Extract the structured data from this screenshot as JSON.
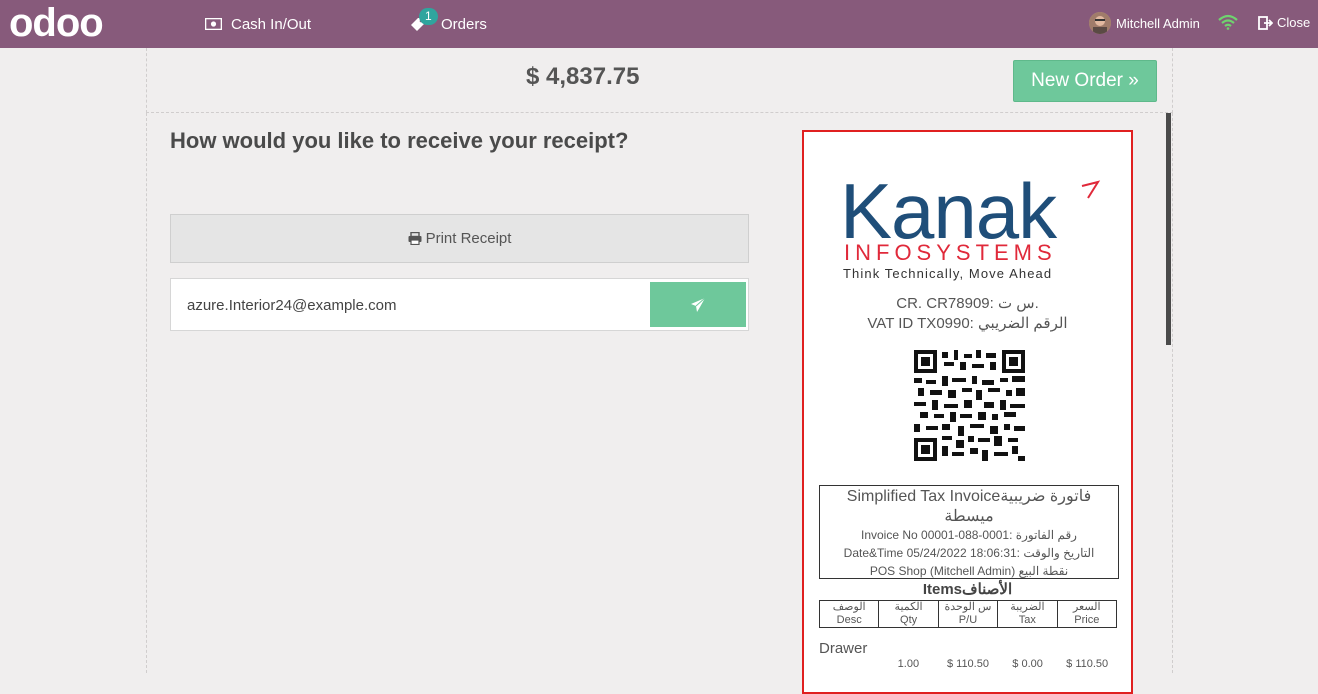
{
  "navbar": {
    "brand": "odoo",
    "cash_label": "Cash In/Out",
    "orders_label": "Orders",
    "orders_count": "1",
    "user_name": "Mitchell Admin",
    "close_label": "Close"
  },
  "payment": {
    "total": "$ 4,837.75",
    "new_order_label": "New Order »"
  },
  "receipt_screen": {
    "question": "How would you like to receive your receipt?",
    "print_label": "Print Receipt",
    "email_value": "azure.Interior24@example.com"
  },
  "receipt": {
    "company_name": "Kanak",
    "company_sub": "INFOSYSTEMS",
    "company_tagline": "Think Technically, Move Ahead",
    "cr_line": "CR. CR78909: س ت.",
    "vat_line": "VAT ID TX0990: الرقم الضريبي",
    "invoice_title_1": "Simplified Tax Invoiceفاتورة ضريبية",
    "invoice_title_2": "ميسطة",
    "invoice_no": "Invoice No 00001-088-0001: رقم الفاتورة",
    "datetime": "Date&Time 05/24/2022 18:06:31: التاريخ والوقت",
    "pos_shop": "POS Shop (Mitchell Admin) نقطة البيع",
    "items_title": "Itemsالأصناف",
    "columns_ar": [
      "الوصف",
      "الكمية",
      "س الوحدة",
      "الضريبة",
      "السعر"
    ],
    "columns_en": [
      "Desc",
      "Qty",
      "P/U",
      "Tax",
      "Price"
    ],
    "lines": [
      {
        "name": "Drawer",
        "qty": "1.00",
        "pu": "$ 110.50",
        "tax": "$ 0.00",
        "price": "$ 110.50"
      }
    ]
  },
  "colors": {
    "navbar": "#875a7b",
    "accent_green": "#6ec89b",
    "badge": "#2fa59e",
    "receipt_border": "#e02020",
    "logo_blue": "#1f4e79",
    "logo_red": "#e0293a"
  },
  "icons": [
    "cash-icon",
    "orders-icon",
    "wifi-icon",
    "close-icon",
    "print-icon",
    "send-icon"
  ]
}
